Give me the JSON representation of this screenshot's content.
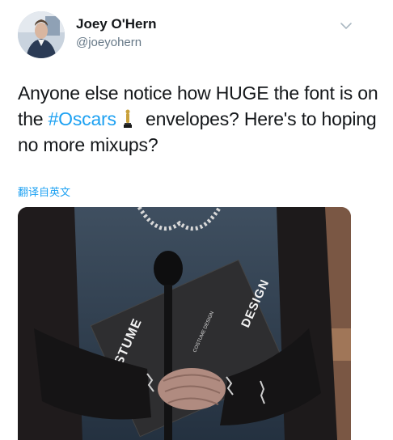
{
  "user": {
    "name": "Joey O'Hern",
    "handle": "@joeyohern"
  },
  "tweet": {
    "part1": "Anyone else notice how HUGE the font is on the ",
    "hashtag": "#Oscars",
    "part2": " envelopes? Here's to hoping no more mixups?",
    "translate_label": "翻译自英文"
  },
  "media": {
    "envelope_left_text": "COSTUME",
    "envelope_mid_text": "COSTUME DESIGN",
    "envelope_right_text": "DESIGN"
  },
  "colors": {
    "link": "#1da1f2",
    "secondary_text": "#657786",
    "primary_text": "#14171a"
  },
  "icons": [
    "chevron-down-icon",
    "oscar-statuette-icon"
  ]
}
